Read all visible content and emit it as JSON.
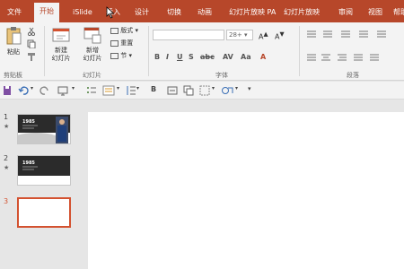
{
  "tabs": [
    "文件",
    "开始",
    "iSlide",
    "插入",
    "设计",
    "切换",
    "动画",
    "幻灯片放映 PA",
    "幻灯片放映",
    "审阅",
    "视图",
    "帮助"
  ],
  "ribbon": {
    "paste_label": "粘贴",
    "new_slide_label": "新建\n幻灯片",
    "reuse_slide_label": "新增\n幻灯片",
    "layout_label": "版式",
    "reset_label": "重置",
    "section_label": "节",
    "font_size_value": "28+",
    "groups": {
      "clipboard": "剪贴板",
      "slides": "幻灯片",
      "font": "字体",
      "paragraph": "段落"
    }
  },
  "slides": [
    {
      "number": "1",
      "star": "★",
      "title": "1985",
      "active": false
    },
    {
      "number": "2",
      "star": "★",
      "title": "1985",
      "active": false
    },
    {
      "number": "3",
      "star": "",
      "title": "",
      "active": true
    }
  ],
  "colors": {
    "accent": "#b7472a",
    "selection": "#d35230"
  }
}
